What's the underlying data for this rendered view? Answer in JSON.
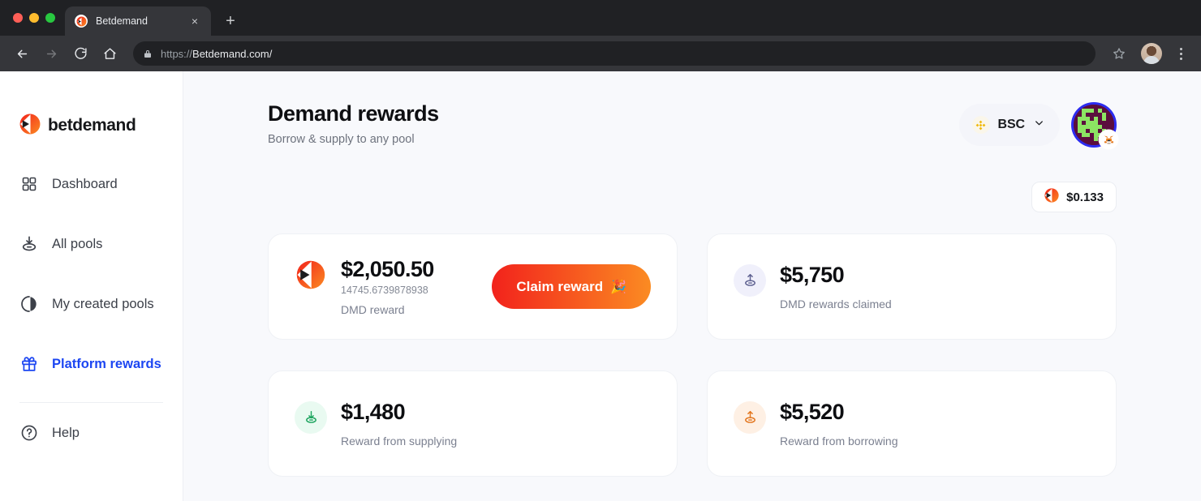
{
  "browser": {
    "tab": {
      "title": "Betdemand",
      "favicon": "betdemand-logo-icon",
      "close_label": "×"
    },
    "new_tab_label": "+",
    "nav": {
      "back": "←",
      "forward": "→",
      "reload": "↻",
      "home": "⌂"
    },
    "address": {
      "scheme": "https://",
      "host": "Betdemand.com/",
      "lock_icon": "lock-icon"
    },
    "bookmark_icon": "star-icon",
    "menu_icon": "kebab-menu-icon"
  },
  "sidebar": {
    "logo_text": "betdemand",
    "items": [
      {
        "label": "Dashboard",
        "icon": "grid-icon",
        "active": false
      },
      {
        "label": "All pools",
        "icon": "download-pool-icon",
        "active": false
      },
      {
        "label": "My created pools",
        "icon": "split-circle-icon",
        "active": false
      },
      {
        "label": "Platform rewards",
        "icon": "gift-icon",
        "active": true
      }
    ],
    "help": {
      "label": "Help",
      "icon": "help-circle-icon"
    }
  },
  "header": {
    "title": "Demand rewards",
    "subtitle": "Borrow & supply to any pool",
    "chain": {
      "name": "BSC",
      "icon": "bnb-icon",
      "chevron": "chevron-down-icon"
    },
    "avatar": {
      "name": "user-avatar",
      "wallet_badge": "metamask-fox-icon"
    }
  },
  "price_chip": {
    "icon": "dmd-token-icon",
    "value": "$0.133"
  },
  "cards": [
    {
      "icon": "dmd-token-icon",
      "icon_style": "plain",
      "amount": "$2,050.50",
      "raw": "14745.6739878938",
      "label": "DMD reward",
      "button": {
        "label": "Claim reward",
        "emoji": "🎉"
      }
    },
    {
      "icon": "upload-icon",
      "icon_style": "lav",
      "amount": "$5,750",
      "raw": "",
      "label": "DMD rewards claimed",
      "button": null
    },
    {
      "icon": "download-icon",
      "icon_style": "mint",
      "amount": "$1,480",
      "raw": "",
      "label": "Reward from supplying",
      "button": null
    },
    {
      "icon": "upload-icon",
      "icon_style": "peach",
      "amount": "$5,520",
      "raw": "",
      "label": "Reward from borrowing",
      "button": null
    }
  ],
  "colors": {
    "accent_blue": "#1C46F2",
    "brand_red": "#F2221C",
    "brand_orange": "#FB8B22",
    "page_bg": "#F8F9FC",
    "card_bg": "#FFFFFF",
    "muted_text": "#7B8090"
  }
}
